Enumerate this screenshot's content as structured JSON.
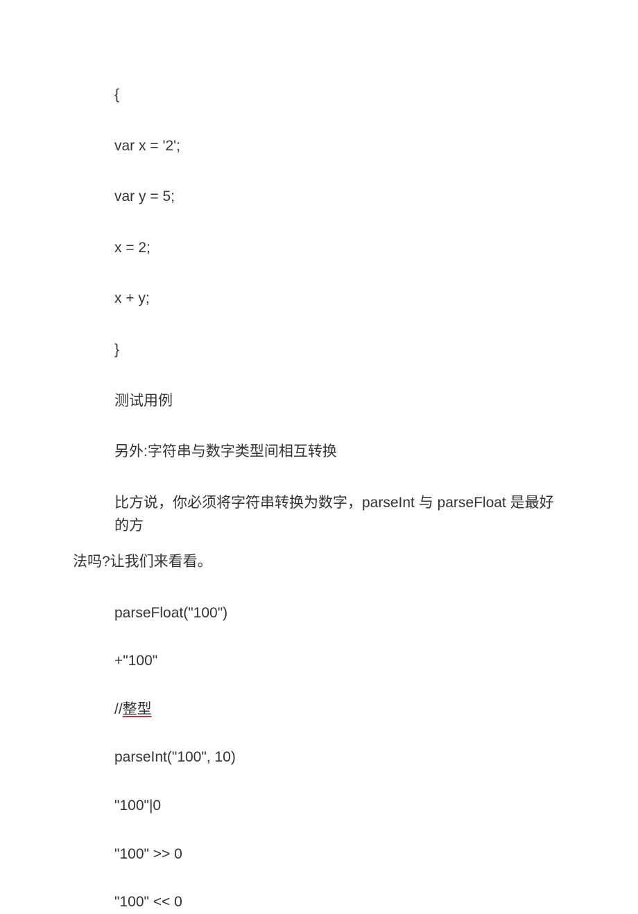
{
  "lines": {
    "l1": "{",
    "l2": "var x = '2';",
    "l3": "var y = 5;",
    "l4": "x = 2;",
    "l5": "x + y;",
    "l6": "}",
    "l7": "测试用例",
    "l8": "另外:字符串与数字类型间相互转换",
    "l9a": "比方说，你必须将字符串转换为数字，parseInt 与 parseFloat 是最好的方",
    "l9b": "法吗?让我们来看看。",
    "l10": "parseFloat(\"100\")",
    "l11": "+\"100\"",
    "l12_prefix": "//",
    "l12_underlined": "整型",
    "l13": "parseInt(\"100\", 10)",
    "l14": "\"100\"|0",
    "l15": "\"100\" >> 0",
    "l16": "\"100\" << 0"
  }
}
